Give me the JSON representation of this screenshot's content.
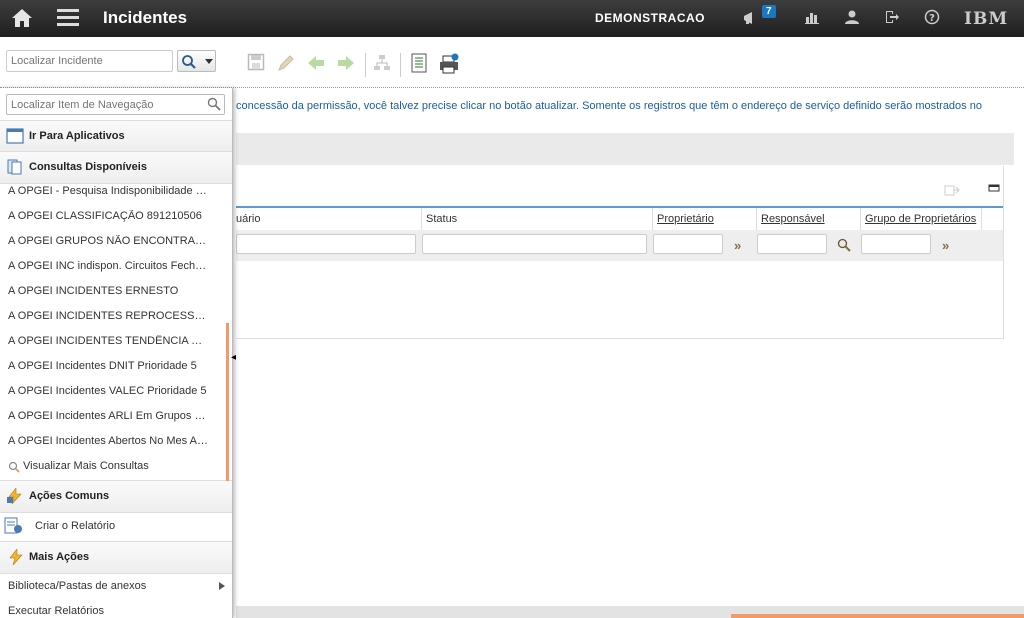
{
  "header": {
    "title": "Incidentes",
    "user": "DEMONSTRACAO",
    "notifications_count": "7",
    "brand": "IBM"
  },
  "toolbar": {
    "search_placeholder": "Localizar Incidente"
  },
  "main": {
    "info_text": "concessão da permissão, você talvez precise clicar no botão atualizar. Somente os registros que têm o endereço de serviço definido serão mostrados no",
    "columns": [
      "uário",
      "Status",
      "Proprietário",
      "Responsável",
      "Grupo de Proprietários"
    ]
  },
  "nav": {
    "search_placeholder": "Localizar Item de Navegação",
    "goto_apps": "Ir Para Aplicativos",
    "queries_title": "Consultas Disponíveis",
    "queries": [
      "A OPGEI - Pesquisa Indisponibilidade Circuitos",
      "A OPGEI CLASSIFICAÇÃO 891210506",
      "A OPGEI GRUPOS NÃO ENCONTRADOS",
      "A OPGEI INC indispon. Circuitos Fechados",
      "A OPGEI INCIDENTES ERNESTO",
      "A OPGEI INCIDENTES REPROCESSADOS",
      "A OPGEI INCIDENTES TENDÊNCIA MENSAL",
      "A OPGEI Incidentes DNIT Prioridade 5",
      "A OPGEI Incidentes VALEC Prioridade 5",
      "A OPGEI Incidentes ARLI Em Grupos Internos",
      "A OPGEI Incidentes Abertos No Mes Atual"
    ],
    "more_queries": "Visualizar Mais Consultas",
    "common_actions_title": "Ações Comuns",
    "create_report": "Criar o Relatório",
    "more_actions_title": "Mais Ações",
    "library": "Biblioteca/Pastas de anexos",
    "run_reports": "Executar Relatórios"
  },
  "colors": {
    "header_bg": "#2b2b2b",
    "info_text": "#1b5ea3",
    "accent": "#f19a6c",
    "badge": "#1a78c2"
  }
}
